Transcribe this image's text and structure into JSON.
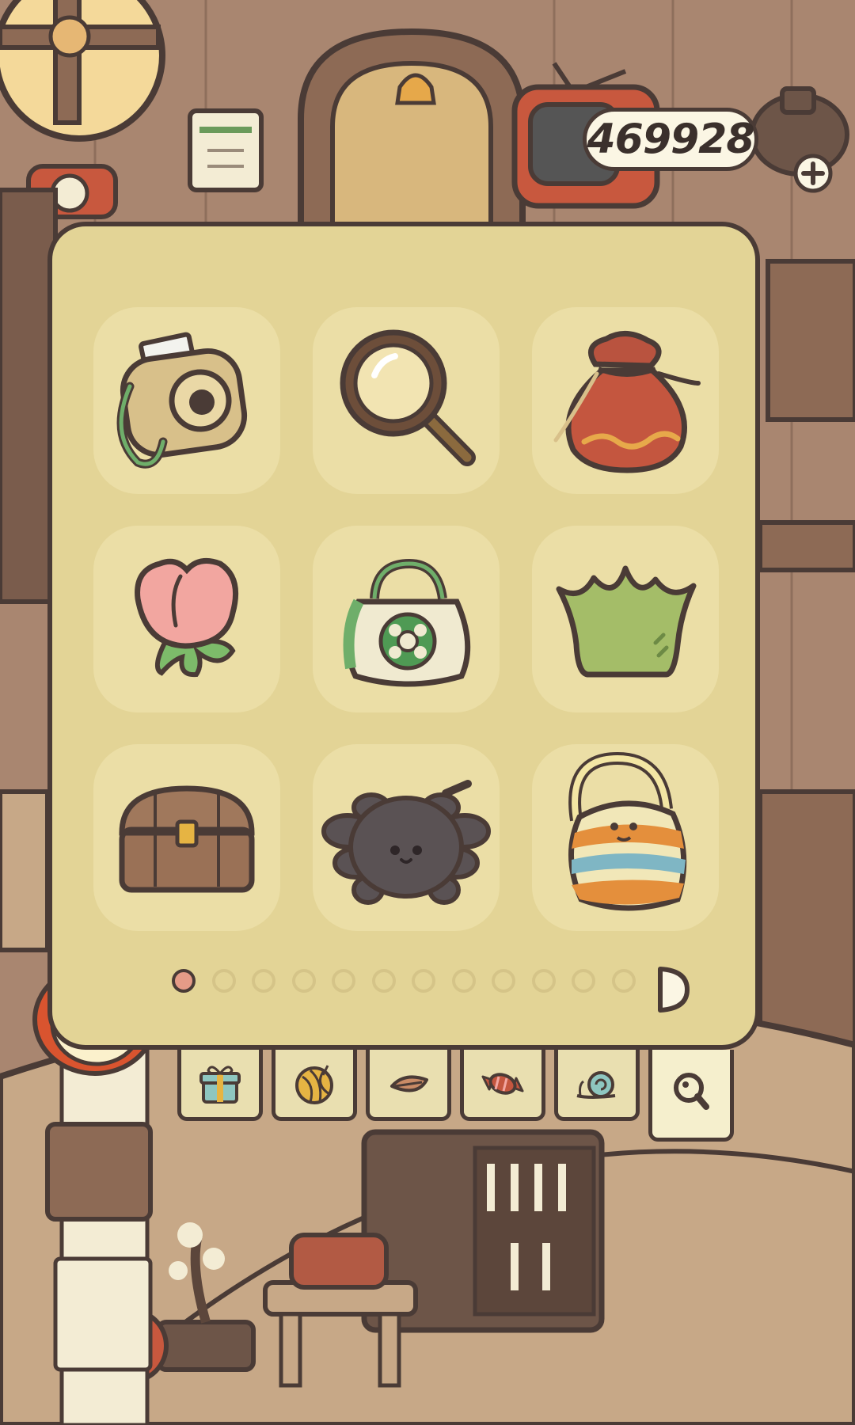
{
  "currency": {
    "amount": "469928",
    "add_icon": "plus-icon"
  },
  "inventory": {
    "items": [
      {
        "name": "instant-camera",
        "icon": "camera-icon"
      },
      {
        "name": "magnifying-glass",
        "icon": "magnifying-glass-icon"
      },
      {
        "name": "lucky-pouch",
        "icon": "pouch-icon"
      },
      {
        "name": "tulip",
        "icon": "tulip-icon"
      },
      {
        "name": "flower-tote-bag",
        "icon": "tote-bag-icon"
      },
      {
        "name": "leaf-crown",
        "icon": "crown-icon"
      },
      {
        "name": "treasure-chest",
        "icon": "chest-icon"
      },
      {
        "name": "spider",
        "icon": "spider-icon"
      },
      {
        "name": "knitted-bag",
        "icon": "knitted-bag-icon"
      }
    ],
    "pagination": {
      "current_page": 1,
      "total_pages": 12
    }
  },
  "tabs": [
    {
      "name": "gifts",
      "icon": "gift-icon",
      "active": false
    },
    {
      "name": "yarn",
      "icon": "yarn-ball-icon",
      "active": false
    },
    {
      "name": "leaves",
      "icon": "leaf-icon",
      "active": false
    },
    {
      "name": "candy",
      "icon": "candy-icon",
      "active": false
    },
    {
      "name": "snail",
      "icon": "snail-icon",
      "active": false
    },
    {
      "name": "search",
      "icon": "search-icon",
      "active": true
    }
  ],
  "colors": {
    "outline": "#4a3b36",
    "panel_bg": "#e3d496",
    "slot_bg": "#ebdea6",
    "active_dot": "#e59b87"
  }
}
